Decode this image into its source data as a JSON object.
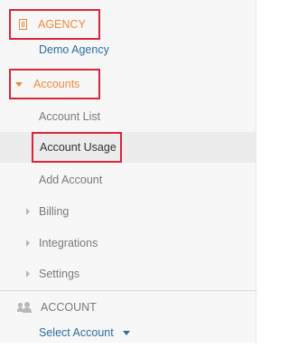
{
  "agency": {
    "header_label": "AGENCY",
    "current_agency": "Demo Agency"
  },
  "accounts": {
    "header_label": "Accounts",
    "items": [
      {
        "label": "Account List"
      },
      {
        "label": "Account Usage"
      },
      {
        "label": "Add Account"
      }
    ]
  },
  "collapsed_sections": [
    {
      "label": "Billing"
    },
    {
      "label": "Integrations"
    },
    {
      "label": "Settings"
    }
  ],
  "account": {
    "header_label": "ACCOUNT",
    "select_label": "Select Account"
  },
  "colors": {
    "accent_orange": "#f08a3a",
    "link_blue": "#2a6ea0",
    "highlight_red": "#d9253b"
  }
}
